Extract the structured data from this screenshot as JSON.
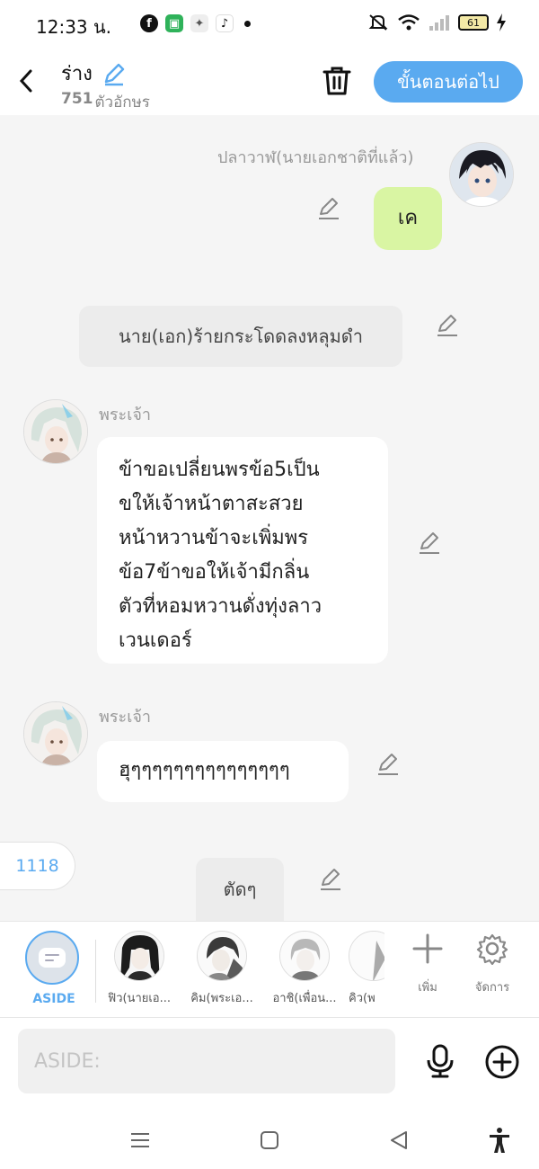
{
  "status_bar": {
    "time": "12:33 น.",
    "battery": "61",
    "apps": [
      "facebook-icon",
      "green-app-icon",
      "game-icon",
      "tiktok-icon"
    ]
  },
  "header": {
    "title": "ร่าง",
    "char_count": "751",
    "char_count_suffix": "ตัวอักษร",
    "next_label": "ขั้นตอนต่อไป"
  },
  "messages": [
    {
      "type": "self",
      "sender": "ปลาวาฬ(นายเอกชาติที่แล้ว)",
      "text": "เค"
    },
    {
      "type": "narration",
      "text": "นาย(เอก)ร้ายกระโดดลงหลุมดำ"
    },
    {
      "type": "other",
      "sender": "พระเจ้า",
      "lines": [
        "ข้าขอเปลี่ยนพรข้อ5เป็น",
        "ขให้เจ้าหน้าตาสะสวย",
        "หน้าหวานข้าจะเพิ่มพร",
        "ข้อ7ข้าขอให้เจ้ามีกลิ่น",
        "ตัวที่หอมหวานดั่งทุ่งลาว",
        "เวนเดอร์"
      ]
    },
    {
      "type": "other",
      "sender": "พระเจ้า",
      "text": "ฮุๆๆๆๆๆๆๆๆๆๆๆๆๆๆๆ"
    },
    {
      "type": "narration",
      "text": "ตัดๆ"
    }
  ],
  "count_pill": "1118",
  "character_bar": {
    "aside_label": "ASIDE",
    "characters": [
      {
        "label": "ฟิว(นายเอ...",
        "avatar": "character-avatar"
      },
      {
        "label": "คิม(พระเอ...",
        "avatar": "character-avatar"
      },
      {
        "label": "อาชิ(เพื่อน...",
        "avatar": "character-avatar"
      },
      {
        "label": "คิว(พ",
        "avatar": "character-avatar"
      }
    ],
    "add_label": "เพิ่ม",
    "manage_label": "จัดการ"
  },
  "input": {
    "placeholder": "ASIDE:"
  },
  "colors": {
    "accent": "#5aaaf0",
    "self_bubble": "#d9f5a3",
    "background": "#f5f5f5"
  }
}
